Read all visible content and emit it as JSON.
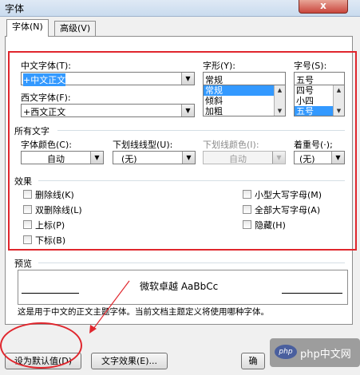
{
  "window": {
    "title": "字体",
    "close_glyph": "x"
  },
  "tabs": [
    {
      "label": "字体(N)"
    },
    {
      "label": "高级(V)"
    }
  ],
  "cn_font": {
    "label": "中文字体(T):",
    "value": "+中文正文"
  },
  "west_font": {
    "label": "西文字体(F):",
    "value": "+西文正文"
  },
  "style": {
    "label": "字形(Y):",
    "value": "常规",
    "options": [
      "常规",
      "倾斜",
      "加粗"
    ],
    "selected": "常规"
  },
  "size": {
    "label": "字号(S):",
    "value": "五号",
    "options": [
      "四号",
      "小四",
      "五号"
    ],
    "selected": "五号"
  },
  "all_text": {
    "label": "所有文字"
  },
  "font_color": {
    "label": "字体颜色(C):",
    "value": "自动"
  },
  "underline_type": {
    "label": "下划线线型(U):",
    "value": "(无)"
  },
  "underline_color": {
    "label": "下划线颜色(I):",
    "value": "自动"
  },
  "emphasis": {
    "label": "着重号(·);",
    "value": "(无)"
  },
  "effects": {
    "label": "效果",
    "left": [
      "删除线(K)",
      "双删除线(L)",
      "上标(P)",
      "下标(B)"
    ],
    "right": [
      "小型大写字母(M)",
      "全部大写字母(A)",
      "隐藏(H)"
    ]
  },
  "preview": {
    "label": "预览",
    "sample": "微软卓越 AaBbCc",
    "note": "这是用于中文的正文主题字体。当前文档主题定义将使用哪种字体。"
  },
  "buttons": {
    "default": "设为默认值(D)",
    "effects": "文字效果(E)...",
    "ok": "确"
  },
  "watermark": {
    "text": "php中文网"
  },
  "annotation_color": "#e0262d"
}
